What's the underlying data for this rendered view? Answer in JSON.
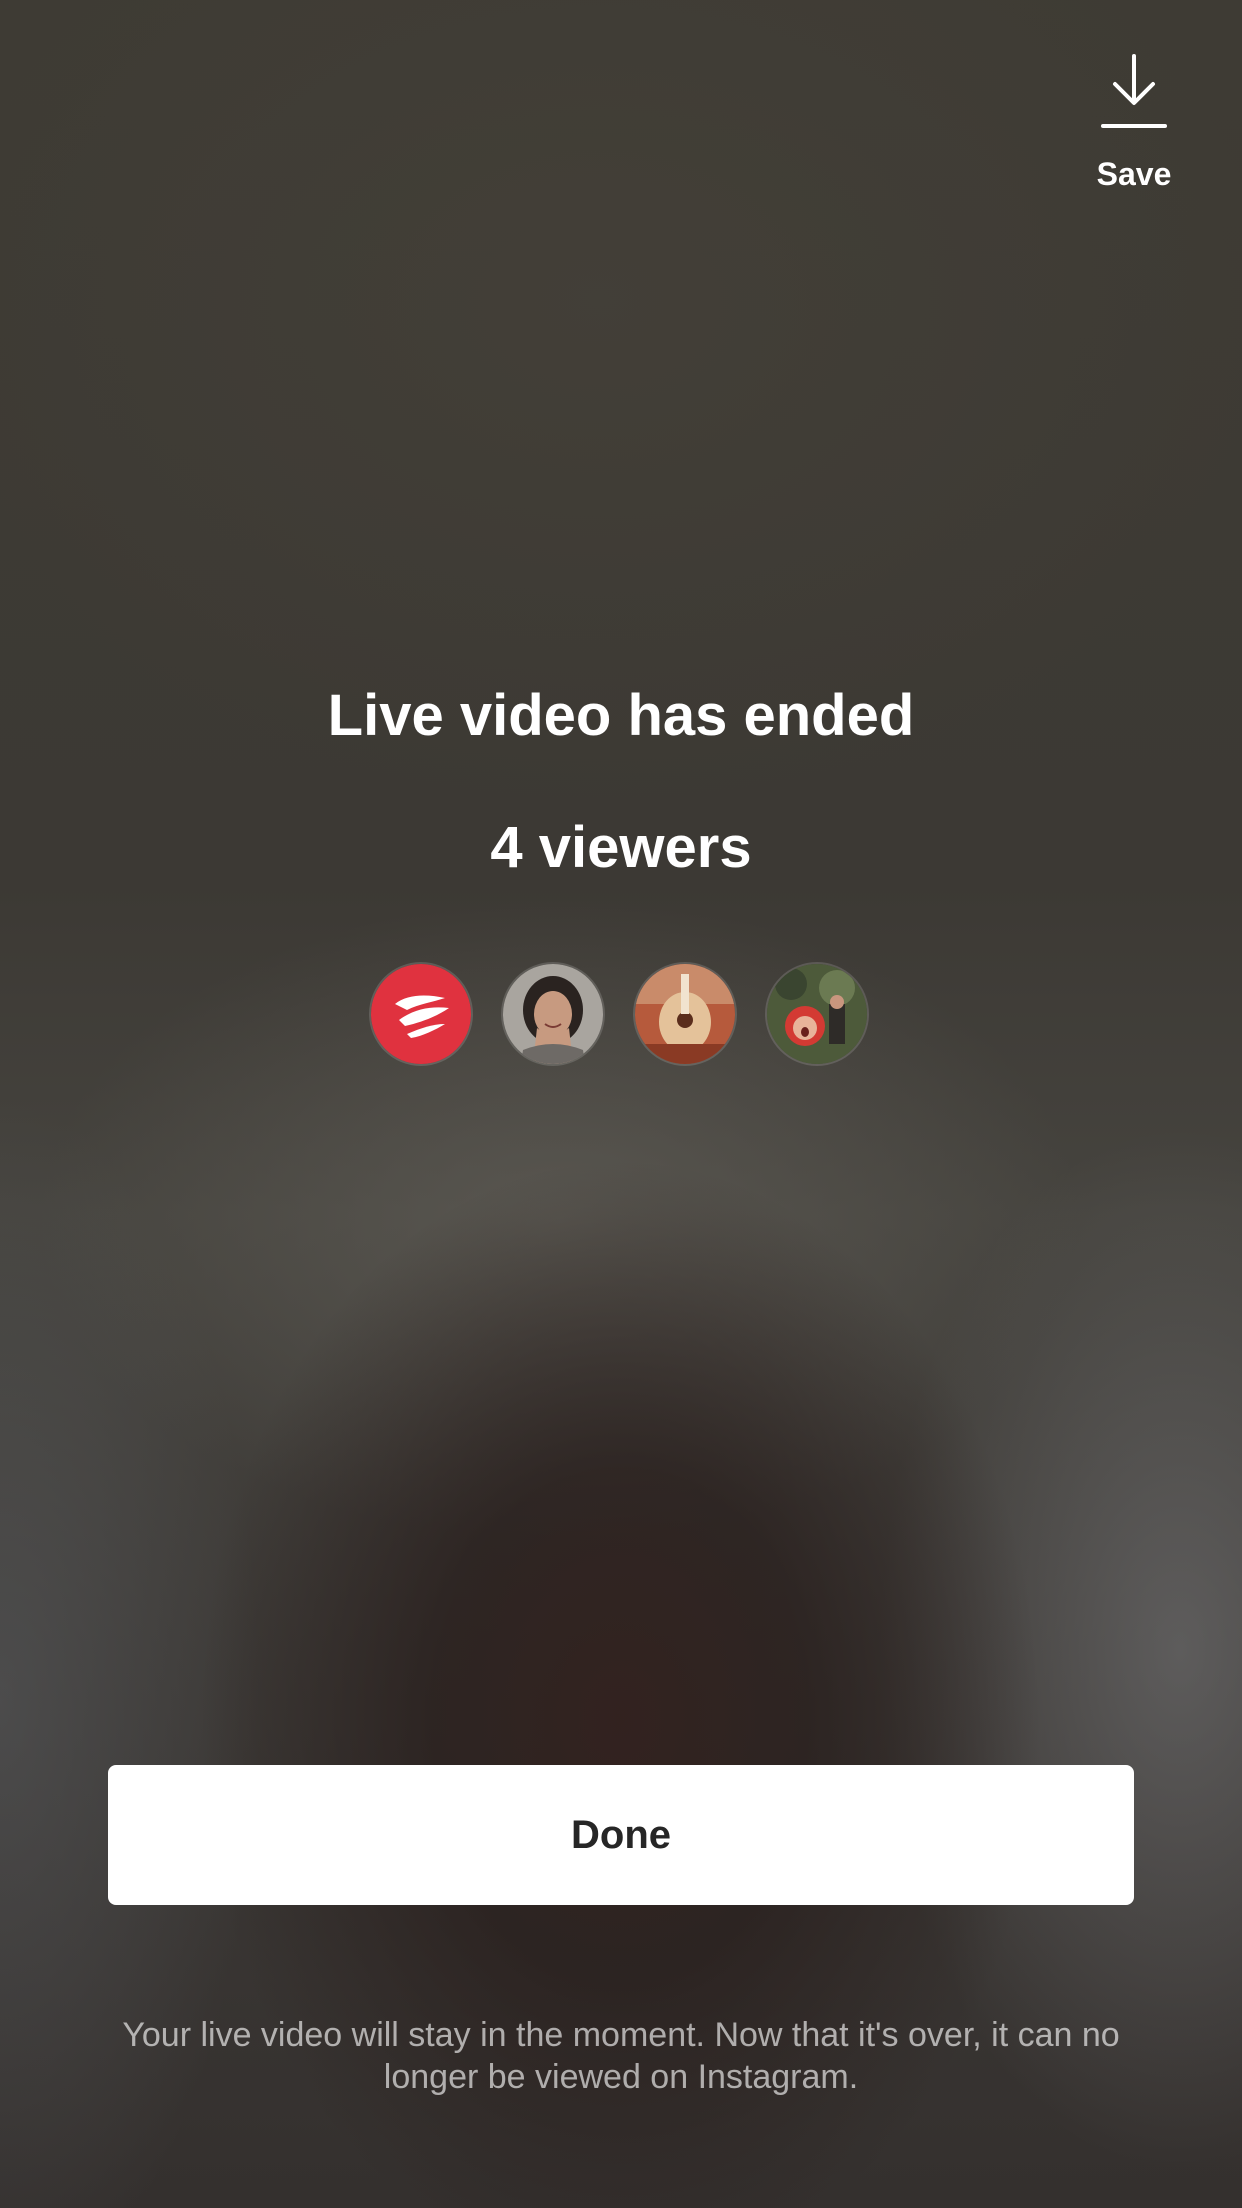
{
  "header": {
    "save_label": "Save",
    "save_icon": "download-icon"
  },
  "main": {
    "title": "Live video has ended",
    "viewers_count_text": "4 viewers",
    "viewer_avatars": [
      {
        "name": "viewer-avatar-brand",
        "accent": "#e0323f"
      },
      {
        "name": "viewer-avatar-woman",
        "accent": "#8e8a86"
      },
      {
        "name": "viewer-avatar-guitar",
        "accent": "#a8452e"
      },
      {
        "name": "viewer-avatar-child",
        "accent": "#5a6a44"
      }
    ]
  },
  "footer": {
    "done_label": "Done",
    "note": "Your live video will stay in the moment. Now that it's over, it can no longer be viewed on Instagram."
  },
  "colors": {
    "button_bg": "#ffffff",
    "button_text": "#262626",
    "brand_red": "#e0323f"
  }
}
